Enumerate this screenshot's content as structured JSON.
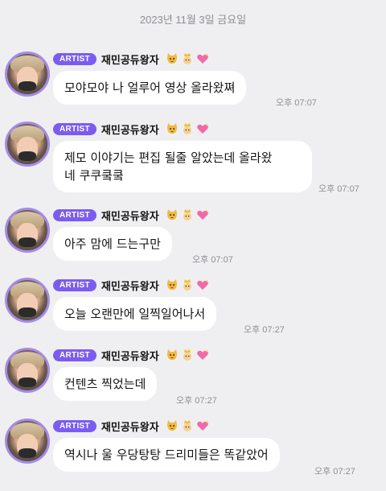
{
  "date_divider": "2023년 11월 3일 금요일",
  "sender": {
    "badge": "ARTIST",
    "nickname": "재민공듀왕자",
    "icons": [
      "cat-face-icon",
      "prince-icon",
      "sparkling-heart-icon"
    ]
  },
  "messages": [
    {
      "text": "모야모야 나 얼루어 영상 올라왔쪄",
      "time": "오후 07:07"
    },
    {
      "text": "제모 이야기는 편집 될줄 알았는데 올라왔\n네 쿠쿠쿸쿸",
      "time": "오후 07:07"
    },
    {
      "text": "아주 맘에 드는구만",
      "time": "오후 07:07"
    },
    {
      "text": "오늘 오랜만에 일찍일어나서",
      "time": "오후 07:27"
    },
    {
      "text": "컨텐츠 찍었는데",
      "time": "오후 07:27"
    },
    {
      "text": "역시나 울 우당탕탕 드리미들은 똑같았어",
      "time": "오후 07:27"
    }
  ]
}
